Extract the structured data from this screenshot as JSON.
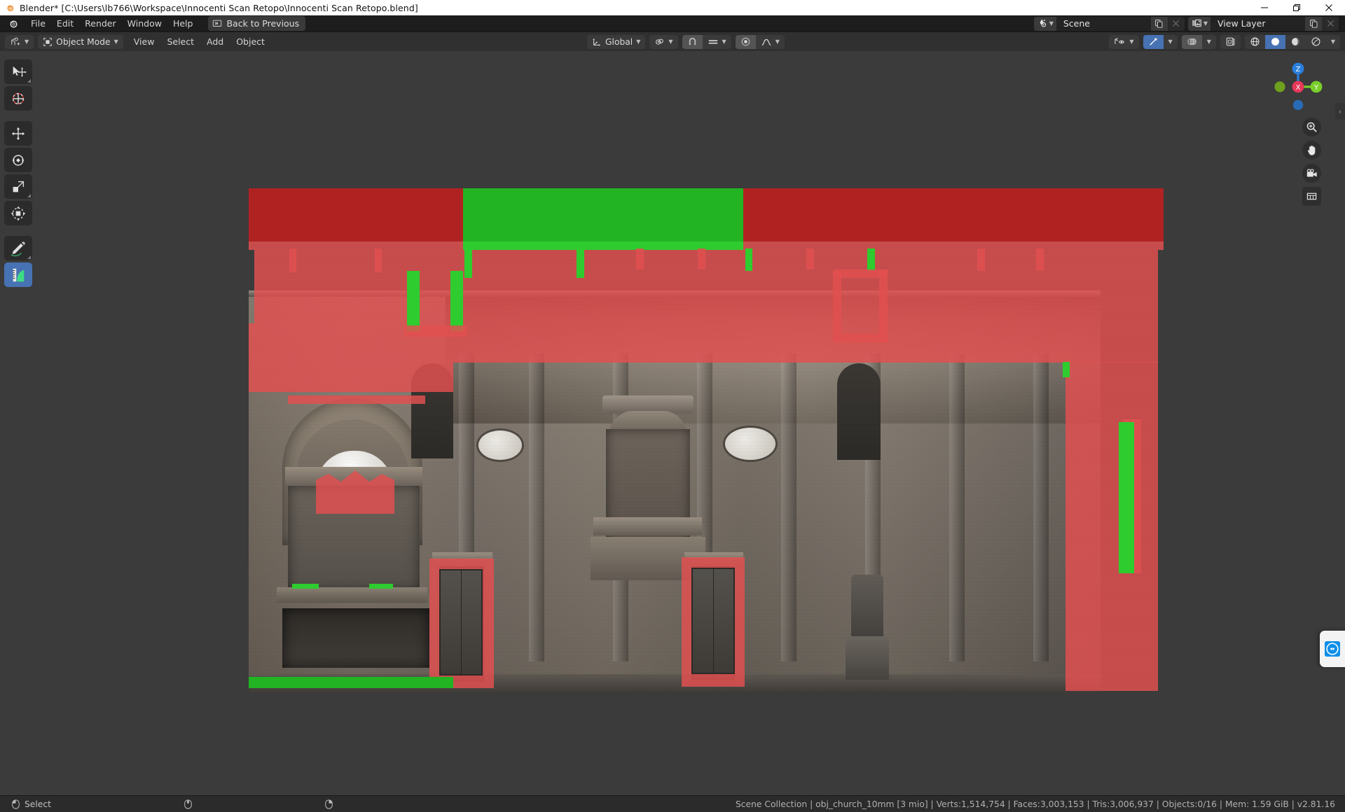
{
  "titlebar": {
    "title": "Blender* [C:\\Users\\lb766\\Workspace\\Innocenti Scan Retopo\\Innocenti Scan Retopo.blend]",
    "icon": "blender-logo-icon",
    "minimize": "—",
    "maximize": "❐",
    "close": "✕"
  },
  "topbar": {
    "menus": [
      "File",
      "Edit",
      "Render",
      "Window",
      "Help"
    ],
    "back_to_previous": "Back to Previous",
    "back_icon": "back-to-previous-icon",
    "scene": {
      "label": "Scene",
      "icon": "scene-icon",
      "new_icon": "new-scene-icon",
      "unlink_icon": "unlink-icon"
    },
    "view_layer": {
      "label": "View Layer",
      "icon": "view-layer-icon",
      "new_icon": "new-view-layer-icon",
      "unlink_icon": "unlink-icon"
    }
  },
  "viewport_header": {
    "editor_type_icon": "editor-type-3d-viewport-icon",
    "mode": "Object Mode",
    "mode_icon": "object-mode-icon",
    "menus": [
      "View",
      "Select",
      "Add",
      "Object"
    ],
    "transform_orientation": "Global",
    "orientation_icon": "transform-orientation-icon",
    "pivot_icon": "pivot-point-icon",
    "snap_magnet_icon": "snap-magnet-icon",
    "snap_to_icon": "snap-to-increment-icon",
    "proportional_edit_icon": "proportional-editing-icon",
    "proportional_falloff_icon": "proportional-falloff-smooth-icon",
    "visibility_icon": "object-type-visibility-icon",
    "gizmo_icon": "show-gizmo-icon",
    "overlays_icon": "show-overlays-icon",
    "xray_icon": "toggle-xray-icon",
    "shading_wireframe_icon": "shading-wireframe-icon",
    "shading_solid_icon": "shading-solid-icon",
    "shading_material_icon": "shading-material-preview-icon",
    "shading_rendered_icon": "shading-rendered-icon",
    "shading_active": "solid"
  },
  "toolbar": {
    "tools": [
      {
        "name": "tweak-tool",
        "icon": "select-tweak-icon",
        "active": false,
        "has_submenu": true
      },
      {
        "name": "cursor-tool",
        "icon": "cursor-3d-icon",
        "active": false,
        "has_submenu": false
      },
      {
        "name": "move-tool",
        "icon": "move-icon",
        "active": false,
        "has_submenu": false
      },
      {
        "name": "rotate-tool",
        "icon": "rotate-icon",
        "active": false,
        "has_submenu": false
      },
      {
        "name": "scale-tool",
        "icon": "scale-icon",
        "active": false,
        "has_submenu": true
      },
      {
        "name": "transform-tool",
        "icon": "transform-icon",
        "active": false,
        "has_submenu": false
      },
      {
        "name": "annotate-tool",
        "icon": "annotate-pencil-icon",
        "active": false,
        "has_submenu": true
      },
      {
        "name": "measure-tool",
        "icon": "measure-ruler-icon",
        "active": true,
        "has_submenu": false
      }
    ]
  },
  "nav_gizmo": {
    "axis_x": "X",
    "axis_y": "Y",
    "axis_z": "Z",
    "colors": {
      "x": "#e8385a",
      "y": "#7ace2a",
      "z": "#2a7fdd"
    },
    "zoom_icon": "zoom-region-icon",
    "pan_icon": "move-view-hand-icon",
    "camera_icon": "camera-view-icon",
    "ortho_icon": "toggle-orthographic-icon",
    "sidebar_toggle_icon": "chevron-left-icon"
  },
  "overlay": {
    "teamviewer_icon": "teamviewer-icon"
  },
  "statusbar": {
    "mouse_left_icon": "mouse-left-button-icon",
    "select_label": "Select",
    "mouse_middle_icon": "mouse-middle-button-icon",
    "mouse_right_icon": "mouse-right-button-icon",
    "info": "Scene Collection | obj_church_10mm [3 mio] | Verts:1,514,754 | Faces:3,003,153 | Tris:3,006,937 | Objects:0/16 | Mem: 1.59 GiB | v2.81.16",
    "stats": {
      "collection": "Scene Collection",
      "object": "obj_church_10mm [3 mio]",
      "verts": "Verts:1,514,754",
      "faces": "Faces:3,003,153",
      "tris": "Tris:3,006,937",
      "objects": "Objects:0/16",
      "memory": "Mem: 1.59 GiB",
      "version": "v2.81.16"
    }
  },
  "theme": {
    "viewport_bg": "#3b3b3b",
    "header_bg": "#303030",
    "topbar_bg": "#1d1d1d",
    "accent_blue": "#4772b3",
    "retopo_red": "#e15050",
    "retopo_red_dark": "#b02222",
    "retopo_green": "#22b422"
  }
}
